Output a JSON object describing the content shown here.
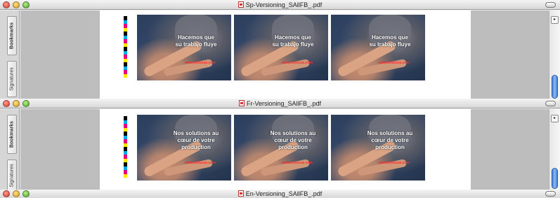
{
  "windows": [
    {
      "title": "Sp-Versioning_SAllFB_.pdf",
      "sidebar_tabs": [
        "Bookmarks",
        "Signatures"
      ],
      "cards": [
        {
          "headline": [
            "Hacemos que",
            "su trabajo fluye"
          ],
          "url": "www.enfocus.com"
        },
        {
          "headline": [
            "Hacemos que",
            "su trabajo fluye"
          ],
          "url": "www.enfocus.com"
        },
        {
          "headline": [
            "Hacemos que",
            "su trabajo fluye"
          ],
          "url": "www.enfocus.com"
        }
      ]
    },
    {
      "title": "Fr-Versioning_SAllFB_.pdf",
      "sidebar_tabs": [
        "Bookmarks",
        "Signatures"
      ],
      "cards": [
        {
          "headline": [
            "Nos solutions au",
            "cœur de votre",
            "production"
          ],
          "url": "www.enfocus.com"
        },
        {
          "headline": [
            "Nos solutions au",
            "cœur de votre",
            "production"
          ],
          "url": "www.enfocus.com"
        },
        {
          "headline": [
            "Nos solutions au",
            "cœur de votre",
            "production"
          ],
          "url": "www.enfocus.com"
        }
      ]
    },
    {
      "title": "En-Versioning_SAllFB_.pdf"
    }
  ],
  "colors": {
    "colorbar": [
      "#000000",
      "#00a9e8",
      "#e6007e",
      "#ffe400",
      "#000000",
      "#00a9e8",
      "#e6007e",
      "#ffe400",
      "#000000",
      "#00a9e8",
      "#e6007e",
      "#ffe400",
      "#000000",
      "#00a9e8",
      "#e6007e",
      "#ffe400"
    ],
    "headline_color": "#ffffff",
    "url_color": "#ff2a2a"
  },
  "icons": {
    "close": "red-close-icon",
    "minimize": "yellow-minimize-icon",
    "zoom": "green-zoom-icon",
    "document": "pdf-document-icon",
    "toolbar": "toolbar-toggle-icon",
    "scroll": "scroll-arrow-icon"
  }
}
